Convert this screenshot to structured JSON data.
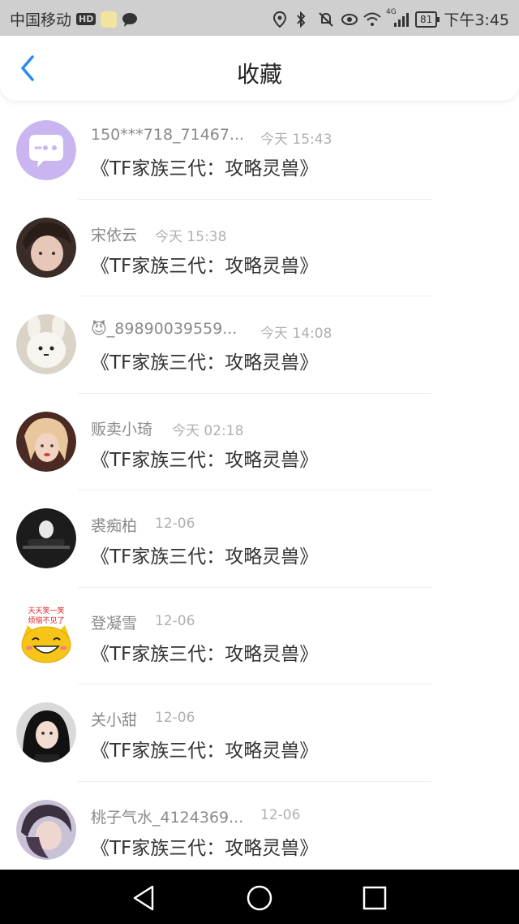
{
  "status_bar": {
    "carrier": "中国移动",
    "hd": "HD",
    "network": "4G",
    "battery": "81",
    "time": "下午3:45"
  },
  "nav": {
    "title": "收藏"
  },
  "items": [
    {
      "name": "150***718_71467...",
      "time": "今天 15:43",
      "text": "《TF家族三代：攻略灵兽》"
    },
    {
      "name": "宋依云",
      "time": "今天 15:38",
      "text": "《TF家族三代：攻略灵兽》"
    },
    {
      "name": "😈_89890039559...",
      "time": "今天 14:08",
      "text": "《TF家族三代：攻略灵兽》"
    },
    {
      "name": "贩卖小琦",
      "time": "今天 02:18",
      "text": "《TF家族三代：攻略灵兽》"
    },
    {
      "name": "裘痴柏",
      "time": "12-06",
      "text": "《TF家族三代：攻略灵兽》"
    },
    {
      "name": "登凝雪",
      "time": "12-06",
      "text": "《TF家族三代：攻略灵兽》"
    },
    {
      "name": "关小甜",
      "time": "12-06",
      "text": "《TF家族三代：攻略灵兽》"
    },
    {
      "name": "桃子气水_4124369...",
      "time": "12-06",
      "text": "《TF家族三代：攻略灵兽》"
    }
  ],
  "avatar_sticker_text": [
    "天天笑一笑",
    "烦恼不见了"
  ],
  "colors": {
    "accent": "#2a8cf0",
    "status_bar_bg": "#cfcfcf",
    "name_text": "#8a8a8a",
    "time_text": "#b0b0b0",
    "title_text": "#333333",
    "default_avatar": "#c9b5f0"
  },
  "icons": {
    "back": "chevron-left-icon",
    "sys_back": "triangle-back-icon",
    "sys_home": "circle-home-icon",
    "sys_recent": "square-recent-icon"
  }
}
